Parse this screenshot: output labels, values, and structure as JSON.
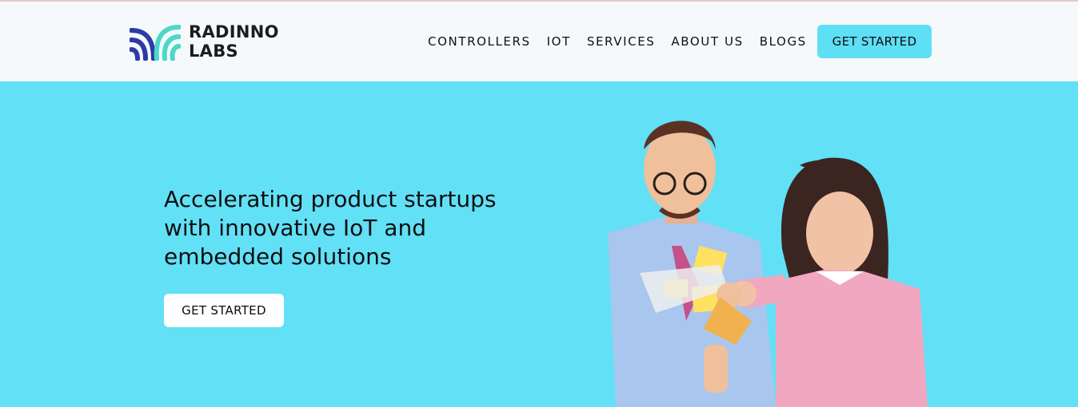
{
  "brand": {
    "name_line1": "RADINNO",
    "name_line2": "LABS",
    "logo_colors": [
      "#2d3aa7",
      "#4dd7c8"
    ]
  },
  "nav": {
    "items": [
      {
        "label": "CONTROLLERS"
      },
      {
        "label": "IOT"
      },
      {
        "label": "SERVICES"
      },
      {
        "label": "ABOUT US"
      },
      {
        "label": "BLOGS"
      }
    ],
    "cta_label": "GET STARTED"
  },
  "hero": {
    "headline_line1": "Accelerating product startups",
    "headline_line2": "with innovative IoT and",
    "headline_line3": "embedded solutions",
    "cta_label": "GET STARTED",
    "background_color": "#62e0f6"
  },
  "colors": {
    "accent": "#5fdff5",
    "header_bg": "#f5f9fc"
  }
}
